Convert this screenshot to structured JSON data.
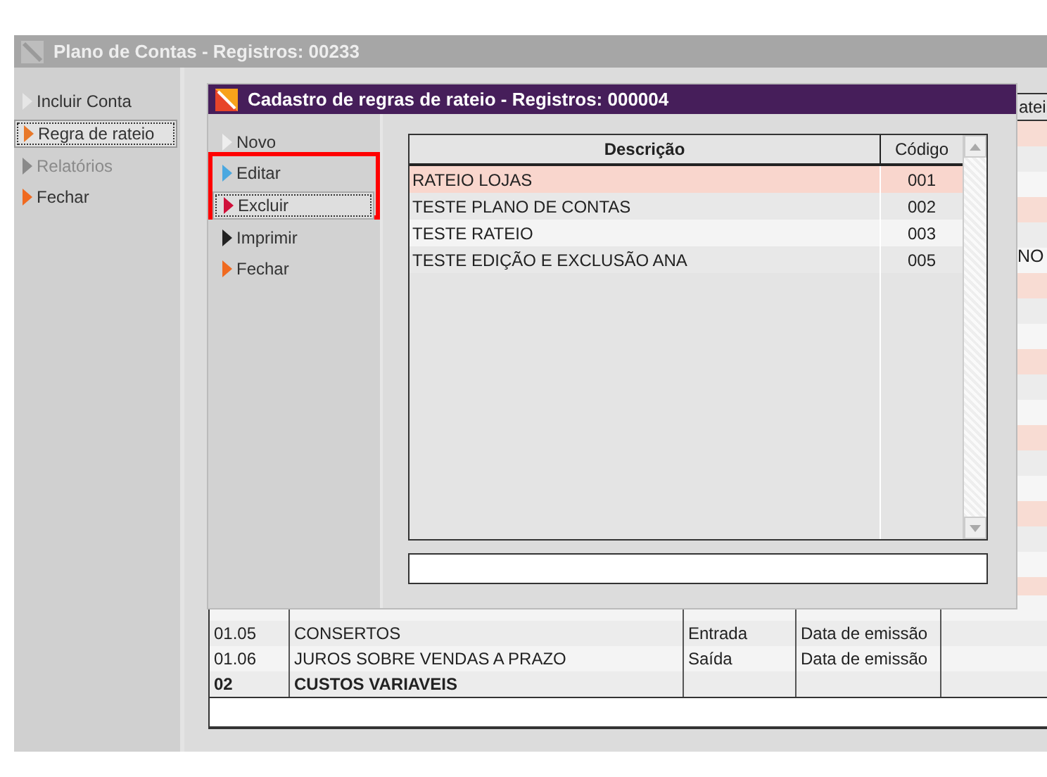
{
  "window": {
    "title": "Plano de Contas - Registros: 00233"
  },
  "sidebar": {
    "items": [
      {
        "label": "Incluir Conta",
        "color": "#e6e6e6",
        "selected": false,
        "disabled": false
      },
      {
        "label": "Regra de rateio",
        "color": "#e8782a",
        "selected": true,
        "disabled": false
      },
      {
        "label": "Relatórios",
        "color": "#8a8a8a",
        "selected": false,
        "disabled": true
      },
      {
        "label": "Fechar",
        "color": "#f06a20",
        "selected": false,
        "disabled": false
      }
    ]
  },
  "background_table": {
    "header_fragment": "atei",
    "row_fragment": "NO",
    "rows": [
      {
        "code": "01.05",
        "description": "CONSERTOS",
        "type": "Entrada",
        "date_basis": "Data de emissão",
        "bold": false
      },
      {
        "code": "01.06",
        "description": "JUROS SOBRE VENDAS A PRAZO",
        "type": "Saída",
        "date_basis": "Data de emissão",
        "bold": false
      },
      {
        "code": "02",
        "description": "CUSTOS  VARIAVEIS",
        "bold": true
      }
    ]
  },
  "dialog": {
    "title": "Cadastro de regras de rateio - Registros: 000004",
    "actions": [
      {
        "label": "Novo",
        "color": "#eeeeee",
        "selected": false
      },
      {
        "label": "Editar",
        "color": "#4aa8e0",
        "selected": false
      },
      {
        "label": "Excluir",
        "color": "#d0103a",
        "selected": true
      },
      {
        "label": "Imprimir",
        "color": "#222222",
        "selected": false
      },
      {
        "label": "Fechar",
        "color": "#f06a20",
        "selected": false
      }
    ],
    "table": {
      "columns": [
        "Descrição",
        "Código"
      ],
      "rows": [
        {
          "description": "RATEIO LOJAS",
          "code": "001",
          "selected": true
        },
        {
          "description": "TESTE PLANO DE CONTAS",
          "code": "002",
          "selected": false
        },
        {
          "description": "TESTE RATEIO",
          "code": "003",
          "selected": false
        },
        {
          "description": "TESTE EDIÇÃO E EXCLUSÃO ANA",
          "code": "005",
          "selected": false
        }
      ]
    }
  }
}
